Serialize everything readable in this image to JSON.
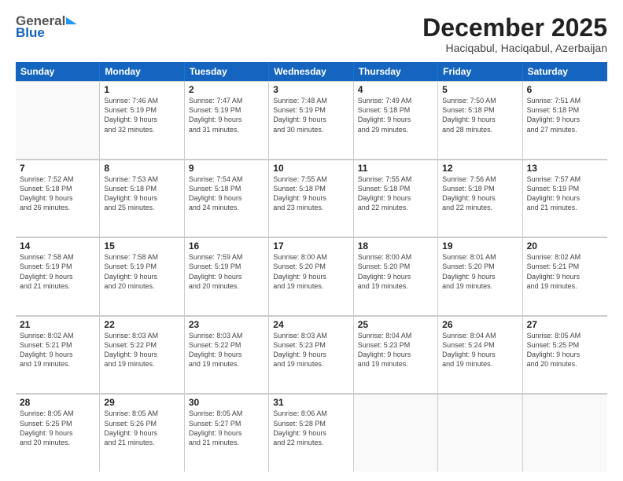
{
  "header": {
    "logo_line1": "General",
    "logo_line2": "Blue",
    "month": "December 2025",
    "location": "Haciqabul, Haciqabul, Azerbaijan"
  },
  "days_of_week": [
    "Sunday",
    "Monday",
    "Tuesday",
    "Wednesday",
    "Thursday",
    "Friday",
    "Saturday"
  ],
  "weeks": [
    [
      {
        "day": "",
        "text": ""
      },
      {
        "day": "1",
        "text": "Sunrise: 7:46 AM\nSunset: 5:19 PM\nDaylight: 9 hours\nand 32 minutes."
      },
      {
        "day": "2",
        "text": "Sunrise: 7:47 AM\nSunset: 5:19 PM\nDaylight: 9 hours\nand 31 minutes."
      },
      {
        "day": "3",
        "text": "Sunrise: 7:48 AM\nSunset: 5:19 PM\nDaylight: 9 hours\nand 30 minutes."
      },
      {
        "day": "4",
        "text": "Sunrise: 7:49 AM\nSunset: 5:18 PM\nDaylight: 9 hours\nand 29 minutes."
      },
      {
        "day": "5",
        "text": "Sunrise: 7:50 AM\nSunset: 5:18 PM\nDaylight: 9 hours\nand 28 minutes."
      },
      {
        "day": "6",
        "text": "Sunrise: 7:51 AM\nSunset: 5:18 PM\nDaylight: 9 hours\nand 27 minutes."
      }
    ],
    [
      {
        "day": "7",
        "text": "Sunrise: 7:52 AM\nSunset: 5:18 PM\nDaylight: 9 hours\nand 26 minutes."
      },
      {
        "day": "8",
        "text": "Sunrise: 7:53 AM\nSunset: 5:18 PM\nDaylight: 9 hours\nand 25 minutes."
      },
      {
        "day": "9",
        "text": "Sunrise: 7:54 AM\nSunset: 5:18 PM\nDaylight: 9 hours\nand 24 minutes."
      },
      {
        "day": "10",
        "text": "Sunrise: 7:55 AM\nSunset: 5:18 PM\nDaylight: 9 hours\nand 23 minutes."
      },
      {
        "day": "11",
        "text": "Sunrise: 7:55 AM\nSunset: 5:18 PM\nDaylight: 9 hours\nand 22 minutes."
      },
      {
        "day": "12",
        "text": "Sunrise: 7:56 AM\nSunset: 5:18 PM\nDaylight: 9 hours\nand 22 minutes."
      },
      {
        "day": "13",
        "text": "Sunrise: 7:57 AM\nSunset: 5:19 PM\nDaylight: 9 hours\nand 21 minutes."
      }
    ],
    [
      {
        "day": "14",
        "text": "Sunrise: 7:58 AM\nSunset: 5:19 PM\nDaylight: 9 hours\nand 21 minutes."
      },
      {
        "day": "15",
        "text": "Sunrise: 7:58 AM\nSunset: 5:19 PM\nDaylight: 9 hours\nand 20 minutes."
      },
      {
        "day": "16",
        "text": "Sunrise: 7:59 AM\nSunset: 5:19 PM\nDaylight: 9 hours\nand 20 minutes."
      },
      {
        "day": "17",
        "text": "Sunrise: 8:00 AM\nSunset: 5:20 PM\nDaylight: 9 hours\nand 19 minutes."
      },
      {
        "day": "18",
        "text": "Sunrise: 8:00 AM\nSunset: 5:20 PM\nDaylight: 9 hours\nand 19 minutes."
      },
      {
        "day": "19",
        "text": "Sunrise: 8:01 AM\nSunset: 5:20 PM\nDaylight: 9 hours\nand 19 minutes."
      },
      {
        "day": "20",
        "text": "Sunrise: 8:02 AM\nSunset: 5:21 PM\nDaylight: 9 hours\nand 19 minutes."
      }
    ],
    [
      {
        "day": "21",
        "text": "Sunrise: 8:02 AM\nSunset: 5:21 PM\nDaylight: 9 hours\nand 19 minutes."
      },
      {
        "day": "22",
        "text": "Sunrise: 8:03 AM\nSunset: 5:22 PM\nDaylight: 9 hours\nand 19 minutes."
      },
      {
        "day": "23",
        "text": "Sunrise: 8:03 AM\nSunset: 5:22 PM\nDaylight: 9 hours\nand 19 minutes."
      },
      {
        "day": "24",
        "text": "Sunrise: 8:03 AM\nSunset: 5:23 PM\nDaylight: 9 hours\nand 19 minutes."
      },
      {
        "day": "25",
        "text": "Sunrise: 8:04 AM\nSunset: 5:23 PM\nDaylight: 9 hours\nand 19 minutes."
      },
      {
        "day": "26",
        "text": "Sunrise: 8:04 AM\nSunset: 5:24 PM\nDaylight: 9 hours\nand 19 minutes."
      },
      {
        "day": "27",
        "text": "Sunrise: 8:05 AM\nSunset: 5:25 PM\nDaylight: 9 hours\nand 20 minutes."
      }
    ],
    [
      {
        "day": "28",
        "text": "Sunrise: 8:05 AM\nSunset: 5:25 PM\nDaylight: 9 hours\nand 20 minutes."
      },
      {
        "day": "29",
        "text": "Sunrise: 8:05 AM\nSunset: 5:26 PM\nDaylight: 9 hours\nand 21 minutes."
      },
      {
        "day": "30",
        "text": "Sunrise: 8:05 AM\nSunset: 5:27 PM\nDaylight: 9 hours\nand 21 minutes."
      },
      {
        "day": "31",
        "text": "Sunrise: 8:06 AM\nSunset: 5:28 PM\nDaylight: 9 hours\nand 22 minutes."
      },
      {
        "day": "",
        "text": ""
      },
      {
        "day": "",
        "text": ""
      },
      {
        "day": "",
        "text": ""
      }
    ]
  ]
}
